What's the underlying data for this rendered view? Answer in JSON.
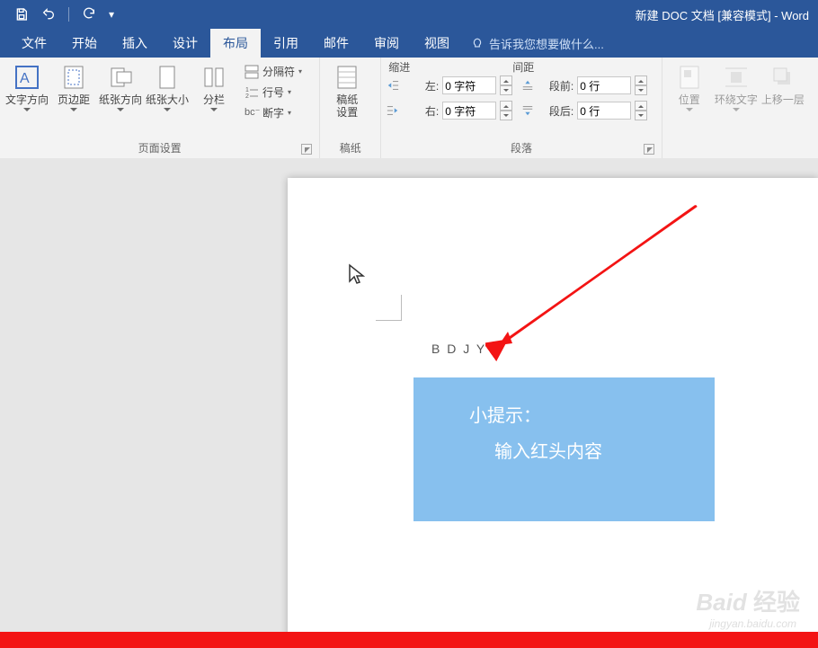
{
  "app_title": "新建 DOC 文档 [兼容模式] - Word",
  "tabs": {
    "file": "文件",
    "home": "开始",
    "insert": "插入",
    "design": "设计",
    "layout": "布局",
    "references": "引用",
    "mailings": "邮件",
    "review": "审阅",
    "view": "视图",
    "tellme": "告诉我您想要做什么..."
  },
  "ribbon": {
    "page_setup": {
      "text_direction": "文字方向",
      "margins": "页边距",
      "orientation": "纸张方向",
      "size": "纸张大小",
      "columns": "分栏",
      "breaks": "分隔符",
      "line_numbers": "行号",
      "hyphenation": "断字",
      "label": "页面设置"
    },
    "manuscript": {
      "setup": "稿纸",
      "setup2": "设置",
      "label": "稿纸"
    },
    "paragraph": {
      "header": "缩进",
      "header2": "间距",
      "left_label": "左:",
      "right_label": "右:",
      "left_val": "0 字符",
      "right_val": "0 字符",
      "before_label": "段前:",
      "after_label": "段后:",
      "before_val": "0 行",
      "after_val": "0 行",
      "label": "段落"
    },
    "arrange": {
      "position": "位置",
      "wrap": "环绕文字",
      "bring_fwd": "上移一层"
    }
  },
  "document": {
    "typed": "B D J Y",
    "tip_title": "小提示：",
    "tip_body": "输入红头内容"
  },
  "watermark": {
    "brand": "Baid",
    "brand2": "经验",
    "url": "jingyan.baidu.com"
  }
}
